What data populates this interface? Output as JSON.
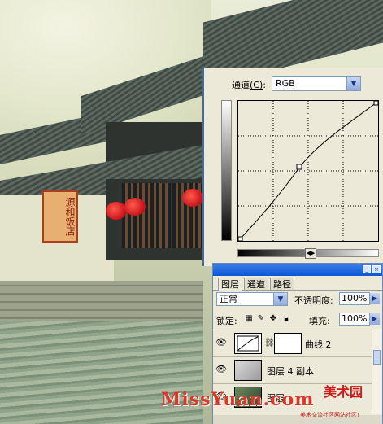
{
  "curves_dialog": {
    "channel_label": "通道",
    "channel_hotkey": "(C)",
    "channel_value": "RGB"
  },
  "layers_panel": {
    "tabs": [
      "图层",
      "通道",
      "路径"
    ],
    "blend_mode": "正常",
    "opacity_label": "不透明度:",
    "opacity_value": "100%",
    "lock_label": "锁定:",
    "fill_label": "填充:",
    "fill_value": "100%",
    "layers": [
      {
        "name": "曲线 2"
      },
      {
        "name": "图层 4 副本"
      },
      {
        "name": "图层"
      }
    ]
  },
  "photo": {
    "banner_text": "源和饭店"
  },
  "watermark": {
    "text": "MissYuan.com",
    "brand": "美术园",
    "slogan": "美术交流社区网站社区!"
  }
}
